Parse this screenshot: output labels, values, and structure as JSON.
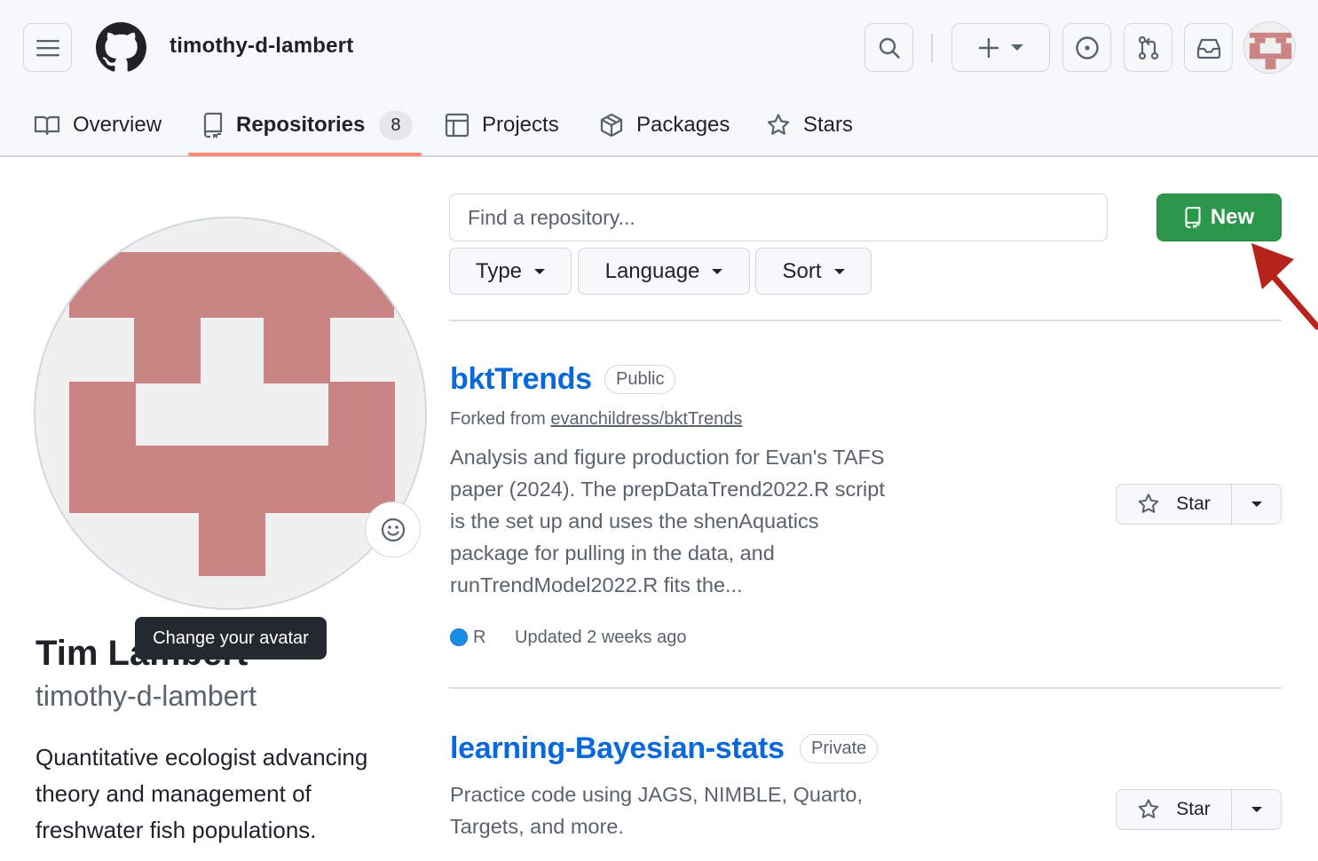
{
  "header": {
    "username": "timothy-d-lambert"
  },
  "nav": {
    "tabs": [
      {
        "label": "Overview",
        "icon": "book-icon"
      },
      {
        "label": "Repositories",
        "icon": "repo-icon",
        "count": "8",
        "selected": true
      },
      {
        "label": "Projects",
        "icon": "table-icon"
      },
      {
        "label": "Packages",
        "icon": "package-icon"
      },
      {
        "label": "Stars",
        "icon": "star-icon"
      }
    ]
  },
  "profile": {
    "full_name": "Tim Lambert",
    "login": "timothy-d-lambert",
    "tooltip": "Change your avatar",
    "bio_lines": [
      "Quantitative ecologist advancing",
      "theory and management of",
      "freshwater fish populations."
    ]
  },
  "filters": {
    "search_placeholder": "Find a repository...",
    "type_label": "Type",
    "language_label": "Language",
    "sort_label": "Sort",
    "new_label": "New"
  },
  "repos": [
    {
      "name": "bktTrends",
      "visibility": "Public",
      "forked_prefix": "Forked from",
      "forked_from": "evanchildress/bktTrends",
      "description_lines": [
        "Analysis and figure production for Evan's TAFS",
        "paper (2024). The prepDataTrend2022.R script",
        "is the set up and uses the shenAquatics",
        "package for pulling in the data, and",
        "runTrendModel2022.R fits the..."
      ],
      "language": "R",
      "language_color": "#198ce7",
      "updated": "Updated 2 weeks ago",
      "star_label": "Star"
    },
    {
      "name": "learning-Bayesian-stats",
      "visibility": "Private",
      "description_lines": [
        "Practice code using JAGS, NIMBLE, Quarto,",
        "Targets, and more."
      ],
      "star_label": "Star"
    }
  ],
  "colors": {
    "accent_green": "#2c974b",
    "link_blue": "#0969da",
    "tab_underline": "#fd8c73",
    "annotation_arrow": "#b5231a",
    "avatar_identicon": "#c98484"
  }
}
